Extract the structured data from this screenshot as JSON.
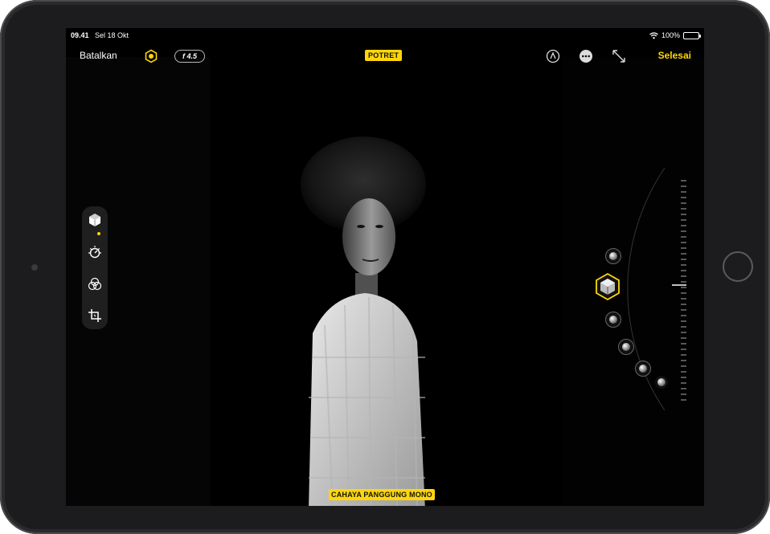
{
  "status_bar": {
    "time": "09.41",
    "date": "Sel 18 Okt",
    "battery": "100%"
  },
  "toolbar": {
    "cancel_label": "Batalkan",
    "aperture_label": "f 4.5",
    "mode_label": "POTRET",
    "done_label": "Selesai",
    "icons": [
      "live-photo-icon",
      "markup-icon",
      "more-icon",
      "expand-icon"
    ]
  },
  "sidebar": {
    "tools": [
      {
        "name": "portrait-lighting-icon",
        "active": true
      },
      {
        "name": "adjust-icon",
        "active": false
      },
      {
        "name": "filters-icon",
        "active": false
      },
      {
        "name": "crop-icon",
        "active": false
      }
    ]
  },
  "lighting": {
    "current_effect": "CAHAYA PANGGUNG MONO",
    "options_icons": [
      "natural-light-icon",
      "stage-light-mono-icon",
      "studio-light-icon",
      "contour-light-icon",
      "stage-light-icon",
      "high-key-light-icon"
    ]
  },
  "colors": {
    "accent": "#ffd60a",
    "background": "#000000",
    "bezel": "#1c1c1e"
  }
}
